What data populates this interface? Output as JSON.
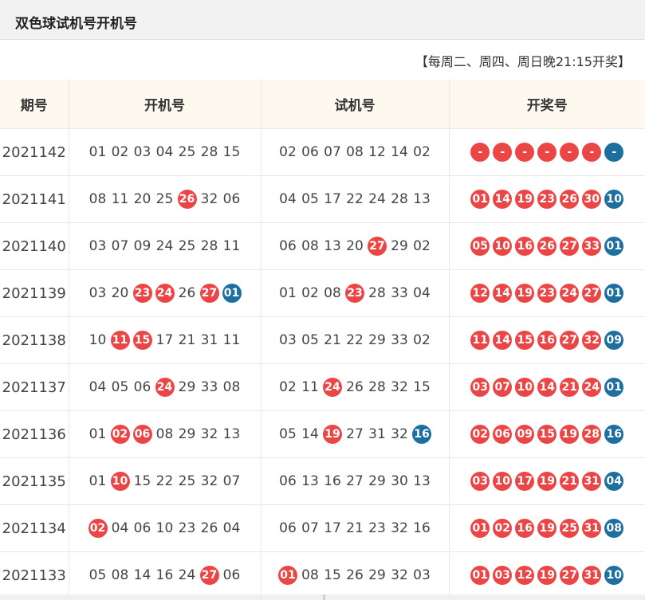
{
  "title": "双色球试机号开机号",
  "notice": "【每周二、周四、周日晚21:15开奖】",
  "columns": [
    "期号",
    "开机号",
    "试机号",
    "开奖号"
  ],
  "colors": {
    "red": "#ec4545",
    "blue": "#1d6fa0",
    "header_bg": "#fdf9ee"
  },
  "rows": [
    {
      "issue": "2021142",
      "kaiji": [
        {
          "n": "01"
        },
        {
          "n": "02"
        },
        {
          "n": "03"
        },
        {
          "n": "04"
        },
        {
          "n": "25"
        },
        {
          "n": "28"
        },
        {
          "n": "15"
        }
      ],
      "shiji": [
        {
          "n": "02"
        },
        {
          "n": "06"
        },
        {
          "n": "07"
        },
        {
          "n": "08"
        },
        {
          "n": "12"
        },
        {
          "n": "14"
        },
        {
          "n": "02"
        }
      ],
      "draw": [
        {
          "n": "-",
          "c": "red"
        },
        {
          "n": "-",
          "c": "red"
        },
        {
          "n": "-",
          "c": "red"
        },
        {
          "n": "-",
          "c": "red"
        },
        {
          "n": "-",
          "c": "red"
        },
        {
          "n": "-",
          "c": "red"
        },
        {
          "n": "-",
          "c": "blue"
        }
      ]
    },
    {
      "issue": "2021141",
      "kaiji": [
        {
          "n": "08"
        },
        {
          "n": "11"
        },
        {
          "n": "20"
        },
        {
          "n": "25"
        },
        {
          "n": "26",
          "c": "red"
        },
        {
          "n": "32"
        },
        {
          "n": "06"
        }
      ],
      "shiji": [
        {
          "n": "04"
        },
        {
          "n": "05"
        },
        {
          "n": "17"
        },
        {
          "n": "22"
        },
        {
          "n": "24"
        },
        {
          "n": "28"
        },
        {
          "n": "13"
        }
      ],
      "draw": [
        {
          "n": "01",
          "c": "red"
        },
        {
          "n": "14",
          "c": "red"
        },
        {
          "n": "19",
          "c": "red"
        },
        {
          "n": "23",
          "c": "red"
        },
        {
          "n": "26",
          "c": "red"
        },
        {
          "n": "30",
          "c": "red"
        },
        {
          "n": "10",
          "c": "blue"
        }
      ]
    },
    {
      "issue": "2021140",
      "kaiji": [
        {
          "n": "03"
        },
        {
          "n": "07"
        },
        {
          "n": "09"
        },
        {
          "n": "24"
        },
        {
          "n": "25"
        },
        {
          "n": "28"
        },
        {
          "n": "11"
        }
      ],
      "shiji": [
        {
          "n": "06"
        },
        {
          "n": "08"
        },
        {
          "n": "13"
        },
        {
          "n": "20"
        },
        {
          "n": "27",
          "c": "red"
        },
        {
          "n": "29"
        },
        {
          "n": "02"
        }
      ],
      "draw": [
        {
          "n": "05",
          "c": "red"
        },
        {
          "n": "10",
          "c": "red"
        },
        {
          "n": "16",
          "c": "red"
        },
        {
          "n": "26",
          "c": "red"
        },
        {
          "n": "27",
          "c": "red"
        },
        {
          "n": "33",
          "c": "red"
        },
        {
          "n": "01",
          "c": "blue"
        }
      ]
    },
    {
      "issue": "2021139",
      "kaiji": [
        {
          "n": "03"
        },
        {
          "n": "20"
        },
        {
          "n": "23",
          "c": "red"
        },
        {
          "n": "24",
          "c": "red"
        },
        {
          "n": "26"
        },
        {
          "n": "27",
          "c": "red"
        },
        {
          "n": "01",
          "c": "blue"
        }
      ],
      "shiji": [
        {
          "n": "01"
        },
        {
          "n": "02"
        },
        {
          "n": "08"
        },
        {
          "n": "23",
          "c": "red"
        },
        {
          "n": "28"
        },
        {
          "n": "33"
        },
        {
          "n": "04"
        }
      ],
      "draw": [
        {
          "n": "12",
          "c": "red"
        },
        {
          "n": "14",
          "c": "red"
        },
        {
          "n": "19",
          "c": "red"
        },
        {
          "n": "23",
          "c": "red"
        },
        {
          "n": "24",
          "c": "red"
        },
        {
          "n": "27",
          "c": "red"
        },
        {
          "n": "01",
          "c": "blue"
        }
      ]
    },
    {
      "issue": "2021138",
      "kaiji": [
        {
          "n": "10"
        },
        {
          "n": "11",
          "c": "red"
        },
        {
          "n": "15",
          "c": "red"
        },
        {
          "n": "17"
        },
        {
          "n": "21"
        },
        {
          "n": "31"
        },
        {
          "n": "11"
        }
      ],
      "shiji": [
        {
          "n": "03"
        },
        {
          "n": "05"
        },
        {
          "n": "21"
        },
        {
          "n": "22"
        },
        {
          "n": "29"
        },
        {
          "n": "33"
        },
        {
          "n": "02"
        }
      ],
      "draw": [
        {
          "n": "11",
          "c": "red"
        },
        {
          "n": "14",
          "c": "red"
        },
        {
          "n": "15",
          "c": "red"
        },
        {
          "n": "16",
          "c": "red"
        },
        {
          "n": "27",
          "c": "red"
        },
        {
          "n": "32",
          "c": "red"
        },
        {
          "n": "09",
          "c": "blue"
        }
      ]
    },
    {
      "issue": "2021137",
      "kaiji": [
        {
          "n": "04"
        },
        {
          "n": "05"
        },
        {
          "n": "06"
        },
        {
          "n": "24",
          "c": "red"
        },
        {
          "n": "29"
        },
        {
          "n": "33"
        },
        {
          "n": "08"
        }
      ],
      "shiji": [
        {
          "n": "02"
        },
        {
          "n": "11"
        },
        {
          "n": "24",
          "c": "red"
        },
        {
          "n": "26"
        },
        {
          "n": "28"
        },
        {
          "n": "32"
        },
        {
          "n": "15"
        }
      ],
      "draw": [
        {
          "n": "03",
          "c": "red"
        },
        {
          "n": "07",
          "c": "red"
        },
        {
          "n": "10",
          "c": "red"
        },
        {
          "n": "14",
          "c": "red"
        },
        {
          "n": "21",
          "c": "red"
        },
        {
          "n": "24",
          "c": "red"
        },
        {
          "n": "01",
          "c": "blue"
        }
      ]
    },
    {
      "issue": "2021136",
      "kaiji": [
        {
          "n": "01"
        },
        {
          "n": "02",
          "c": "red"
        },
        {
          "n": "06",
          "c": "red"
        },
        {
          "n": "08"
        },
        {
          "n": "29"
        },
        {
          "n": "32"
        },
        {
          "n": "13"
        }
      ],
      "shiji": [
        {
          "n": "05"
        },
        {
          "n": "14"
        },
        {
          "n": "19",
          "c": "red"
        },
        {
          "n": "27"
        },
        {
          "n": "31"
        },
        {
          "n": "32"
        },
        {
          "n": "16",
          "c": "blue"
        }
      ],
      "draw": [
        {
          "n": "02",
          "c": "red"
        },
        {
          "n": "06",
          "c": "red"
        },
        {
          "n": "09",
          "c": "red"
        },
        {
          "n": "15",
          "c": "red"
        },
        {
          "n": "19",
          "c": "red"
        },
        {
          "n": "28",
          "c": "red"
        },
        {
          "n": "16",
          "c": "blue"
        }
      ]
    },
    {
      "issue": "2021135",
      "kaiji": [
        {
          "n": "01"
        },
        {
          "n": "10",
          "c": "red"
        },
        {
          "n": "15"
        },
        {
          "n": "22"
        },
        {
          "n": "25"
        },
        {
          "n": "32"
        },
        {
          "n": "07"
        }
      ],
      "shiji": [
        {
          "n": "06"
        },
        {
          "n": "13"
        },
        {
          "n": "16"
        },
        {
          "n": "27"
        },
        {
          "n": "29"
        },
        {
          "n": "30"
        },
        {
          "n": "13"
        }
      ],
      "draw": [
        {
          "n": "03",
          "c": "red"
        },
        {
          "n": "10",
          "c": "red"
        },
        {
          "n": "17",
          "c": "red"
        },
        {
          "n": "19",
          "c": "red"
        },
        {
          "n": "21",
          "c": "red"
        },
        {
          "n": "31",
          "c": "red"
        },
        {
          "n": "04",
          "c": "blue"
        }
      ]
    },
    {
      "issue": "2021134",
      "kaiji": [
        {
          "n": "02",
          "c": "red"
        },
        {
          "n": "04"
        },
        {
          "n": "06"
        },
        {
          "n": "10"
        },
        {
          "n": "23"
        },
        {
          "n": "26"
        },
        {
          "n": "04"
        }
      ],
      "shiji": [
        {
          "n": "06"
        },
        {
          "n": "07"
        },
        {
          "n": "17"
        },
        {
          "n": "21"
        },
        {
          "n": "23"
        },
        {
          "n": "32"
        },
        {
          "n": "16"
        }
      ],
      "draw": [
        {
          "n": "01",
          "c": "red"
        },
        {
          "n": "02",
          "c": "red"
        },
        {
          "n": "16",
          "c": "red"
        },
        {
          "n": "19",
          "c": "red"
        },
        {
          "n": "25",
          "c": "red"
        },
        {
          "n": "31",
          "c": "red"
        },
        {
          "n": "08",
          "c": "blue"
        }
      ]
    },
    {
      "issue": "2021133",
      "kaiji": [
        {
          "n": "05"
        },
        {
          "n": "08"
        },
        {
          "n": "14"
        },
        {
          "n": "16"
        },
        {
          "n": "24"
        },
        {
          "n": "27",
          "c": "red"
        },
        {
          "n": "06"
        }
      ],
      "shiji": [
        {
          "n": "01",
          "c": "red"
        },
        {
          "n": "08"
        },
        {
          "n": "15"
        },
        {
          "n": "26"
        },
        {
          "n": "29"
        },
        {
          "n": "32"
        },
        {
          "n": "03"
        }
      ],
      "draw": [
        {
          "n": "01",
          "c": "red"
        },
        {
          "n": "03",
          "c": "red"
        },
        {
          "n": "12",
          "c": "red"
        },
        {
          "n": "19",
          "c": "red"
        },
        {
          "n": "27",
          "c": "red"
        },
        {
          "n": "31",
          "c": "red"
        },
        {
          "n": "10",
          "c": "blue"
        }
      ]
    }
  ]
}
